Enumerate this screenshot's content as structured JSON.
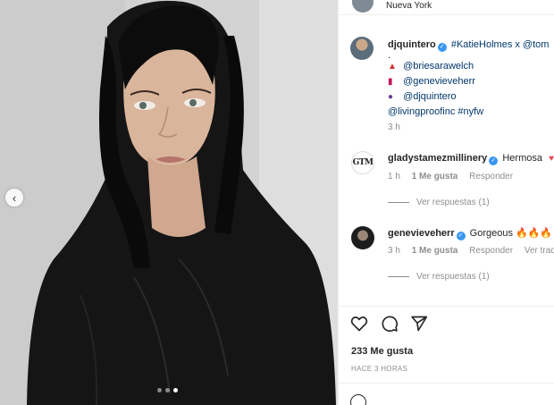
{
  "post": {
    "location": "Nueva York",
    "author": "djquintero",
    "caption": {
      "line1_rest": "#KatieHolmes x @tom",
      "line2": ".",
      "credits": [
        {
          "emoji": "red-dress-emoji",
          "handle": "@briesarawelch"
        },
        {
          "emoji": "lipstick-emoji",
          "handle": "@genevieveherr"
        },
        {
          "emoji": "haircut-emoji",
          "handle": "@djquintero"
        }
      ],
      "tags": "@livingproofinc #nyfw",
      "time": "3 h"
    },
    "image": {
      "carousel_dots": 3,
      "active_dot": 3
    }
  },
  "comments": [
    {
      "user": "gladystamezmillinery",
      "avatar_text": "GTM",
      "text": "Hermosa",
      "time": "1 h",
      "likes": "1 Me gusta",
      "reply": "Responder",
      "translate": "",
      "view_replies": "Ver respuestas (1)"
    },
    {
      "user": "genevieveherr",
      "text": "Gorgeous 🔥🔥🔥",
      "time": "3 h",
      "likes": "1 Me gusta",
      "reply": "Responder",
      "translate": "Ver traduc",
      "view_replies": "Ver respuestas (1)"
    }
  ],
  "engagement": {
    "likes": "233 Me gusta",
    "posted": "HACE 3 HORAS"
  },
  "icons": {
    "like": "heart-outline-icon",
    "comment": "comment-bubble-icon",
    "share": "paper-plane-icon",
    "verified": "verified-badge-icon",
    "nav_prev": "chevron-left-icon"
  },
  "colors": {
    "link": "#00376b",
    "verified": "#3897f0",
    "muted": "#8e8e8e",
    "text": "#262626"
  }
}
